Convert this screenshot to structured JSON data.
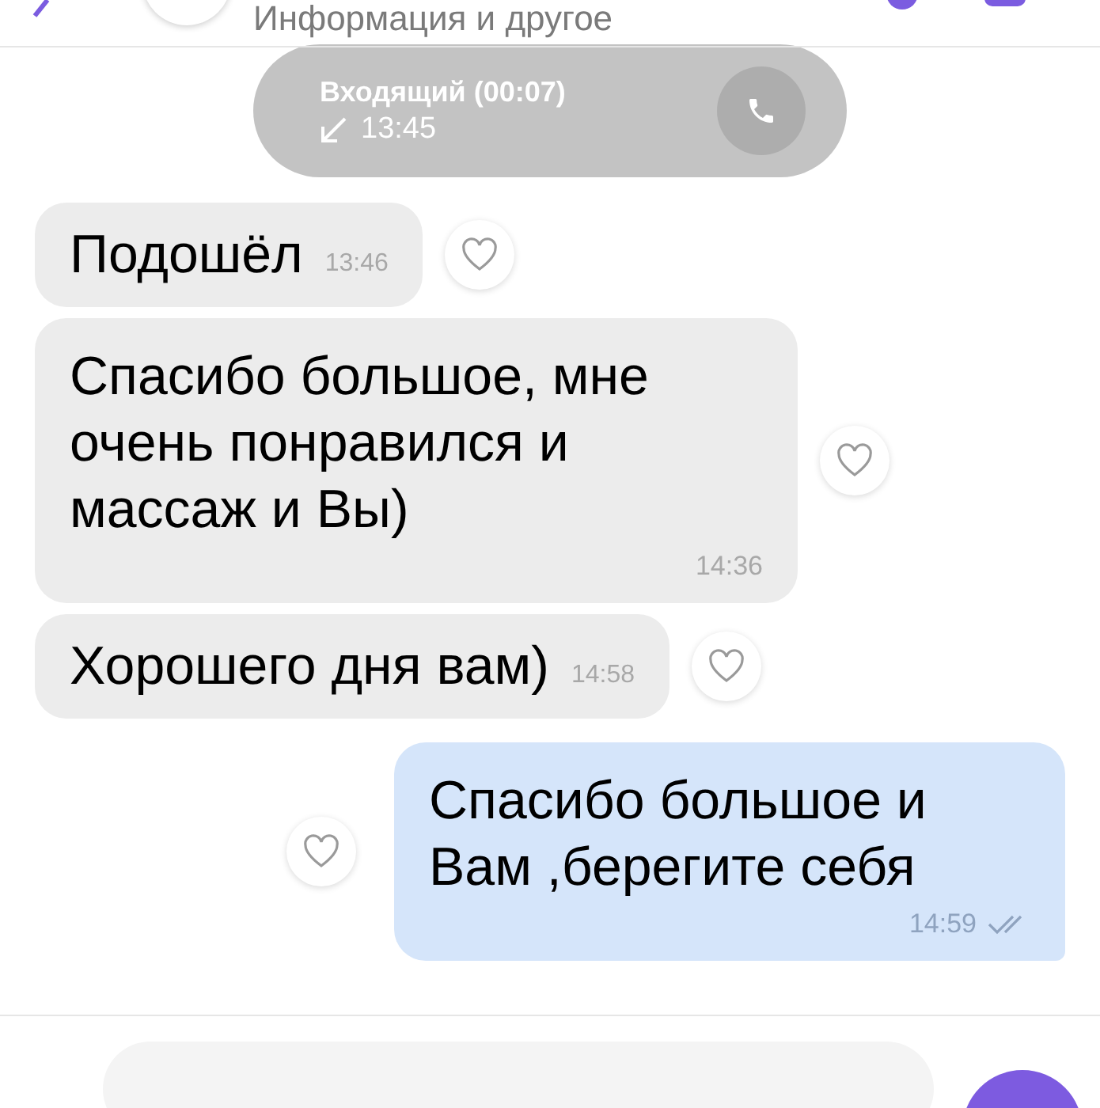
{
  "header": {
    "subtitle": "Информация и другое"
  },
  "call": {
    "label": "Входящий (00:07)",
    "time": "13:45"
  },
  "messages": [
    {
      "kind": "incoming",
      "text": "Подошёл",
      "time": "13:46",
      "inline_time": true
    },
    {
      "kind": "incoming",
      "text": "Спасибо большое, мне очень понравился и массаж и Вы)",
      "time": "14:36",
      "inline_time": false
    },
    {
      "kind": "incoming",
      "text": "Хорошего дня вам)",
      "time": "14:58",
      "inline_time": true
    },
    {
      "kind": "outgoing",
      "text": "Спасибо большое и Вам ,берегите себя",
      "time": "14:59",
      "inline_time": false,
      "read": true
    }
  ]
}
